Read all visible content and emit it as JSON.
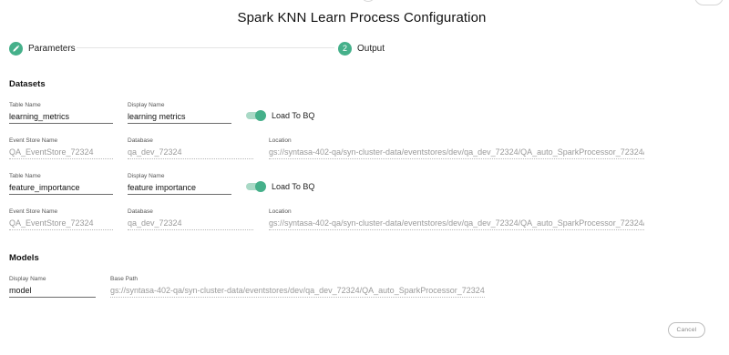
{
  "dialog": {
    "title": "Spark KNN Learn Process Configuration"
  },
  "stepper": {
    "steps": [
      {
        "label": "Parameters",
        "icon": "pencil-icon",
        "state": "completed"
      },
      {
        "number": "2",
        "label": "Output",
        "state": "active"
      }
    ],
    "accent_color": "#45b08a"
  },
  "datasets": {
    "section_title": "Datasets",
    "items": [
      {
        "table_name_label": "Table Name",
        "table_name": "learning_metrics",
        "display_name_label": "Display Name",
        "display_name": "learning metrics",
        "load_to_bq_label": "Load To BQ",
        "load_to_bq": true,
        "event_store_label": "Event Store Name",
        "event_store": "QA_EventStore_72324",
        "database_label": "Database",
        "database": "qa_dev_72324",
        "location_label": "Location",
        "location": "gs://syntasa-402-qa/syn-cluster-data/eventstores/dev/qa_dev_72324/QA_auto_SparkProcessor_72324/"
      },
      {
        "table_name_label": "Table Name",
        "table_name": "feature_importance",
        "display_name_label": "Display Name",
        "display_name": "feature importance",
        "load_to_bq_label": "Load To BQ",
        "load_to_bq": true,
        "event_store_label": "Event Store Name",
        "event_store": "QA_EventStore_72324",
        "database_label": "Database",
        "database": "qa_dev_72324",
        "location_label": "Location",
        "location": "gs://syntasa-402-qa/syn-cluster-data/eventstores/dev/qa_dev_72324/QA_auto_SparkProcessor_72324/"
      }
    ]
  },
  "models": {
    "section_title": "Models",
    "display_name_label": "Display Name",
    "display_name": "model",
    "base_path_label": "Base Path",
    "base_path": "gs://syntasa-402-qa/syn-cluster-data/eventstores/dev/qa_dev_72324/QA_auto_SparkProcessor_72324/"
  },
  "footer": {
    "cancel_label": "Cancel"
  }
}
